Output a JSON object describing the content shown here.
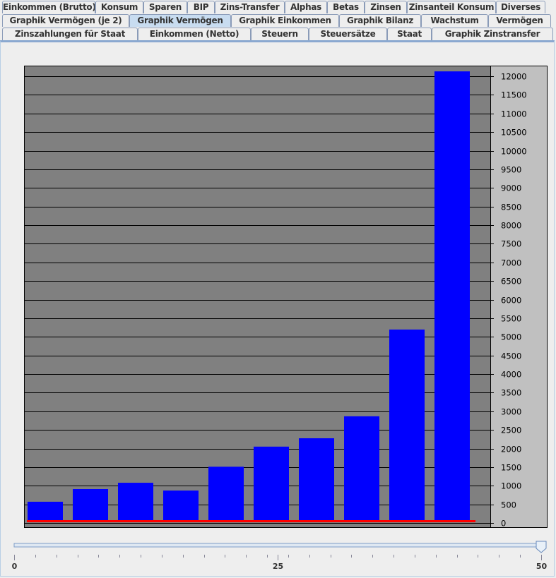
{
  "tabs": {
    "row1": [
      {
        "label": "Einkommen (Brutto)"
      },
      {
        "label": "Konsum"
      },
      {
        "label": "Sparen"
      },
      {
        "label": "BIP"
      },
      {
        "label": "Zins-Transfer"
      },
      {
        "label": "Alphas"
      },
      {
        "label": "Betas"
      },
      {
        "label": "Zinsen"
      },
      {
        "label": "Zinsanteil Konsum"
      },
      {
        "label": "Diverses"
      }
    ],
    "row2": [
      {
        "label": "Graphik Vermögen (je 2)"
      },
      {
        "label": "Graphik Vermögen"
      },
      {
        "label": "Graphik Einkommen"
      },
      {
        "label": "Graphik Bilanz"
      },
      {
        "label": "Wachstum"
      },
      {
        "label": "Vermögen"
      }
    ],
    "row3": [
      {
        "label": "Zinszahlungen für Staat"
      },
      {
        "label": "Einkommen (Netto)"
      },
      {
        "label": "Steuern"
      },
      {
        "label": "Steuersätze"
      },
      {
        "label": "Staat"
      },
      {
        "label": "Graphik Zinstransfer"
      }
    ],
    "selected": "Graphik Vermögen"
  },
  "chart_data": {
    "type": "bar",
    "values": [
      570,
      910,
      1080,
      870,
      1510,
      2050,
      2275,
      2865,
      5195,
      12130
    ],
    "ylim": [
      0,
      12000
    ],
    "yticks": [
      0,
      500,
      1000,
      1500,
      2000,
      2500,
      3000,
      3500,
      4000,
      4500,
      5000,
      5500,
      6000,
      6500,
      7000,
      7500,
      8000,
      8500,
      9000,
      9500,
      10000,
      10500,
      11000,
      11500,
      12000
    ],
    "axis_position": "right",
    "grid": true,
    "baseline_value": 0,
    "colors": {
      "bar": "#0000ff",
      "plot_bg": "#808080",
      "axis_bg": "#c0c0c0",
      "baseline": "#ff0000",
      "grid": "#000000"
    }
  },
  "slider": {
    "min": 0,
    "max": 50,
    "value": 50,
    "labels": [
      "0",
      "25",
      "50"
    ],
    "minor_tick": 2
  }
}
